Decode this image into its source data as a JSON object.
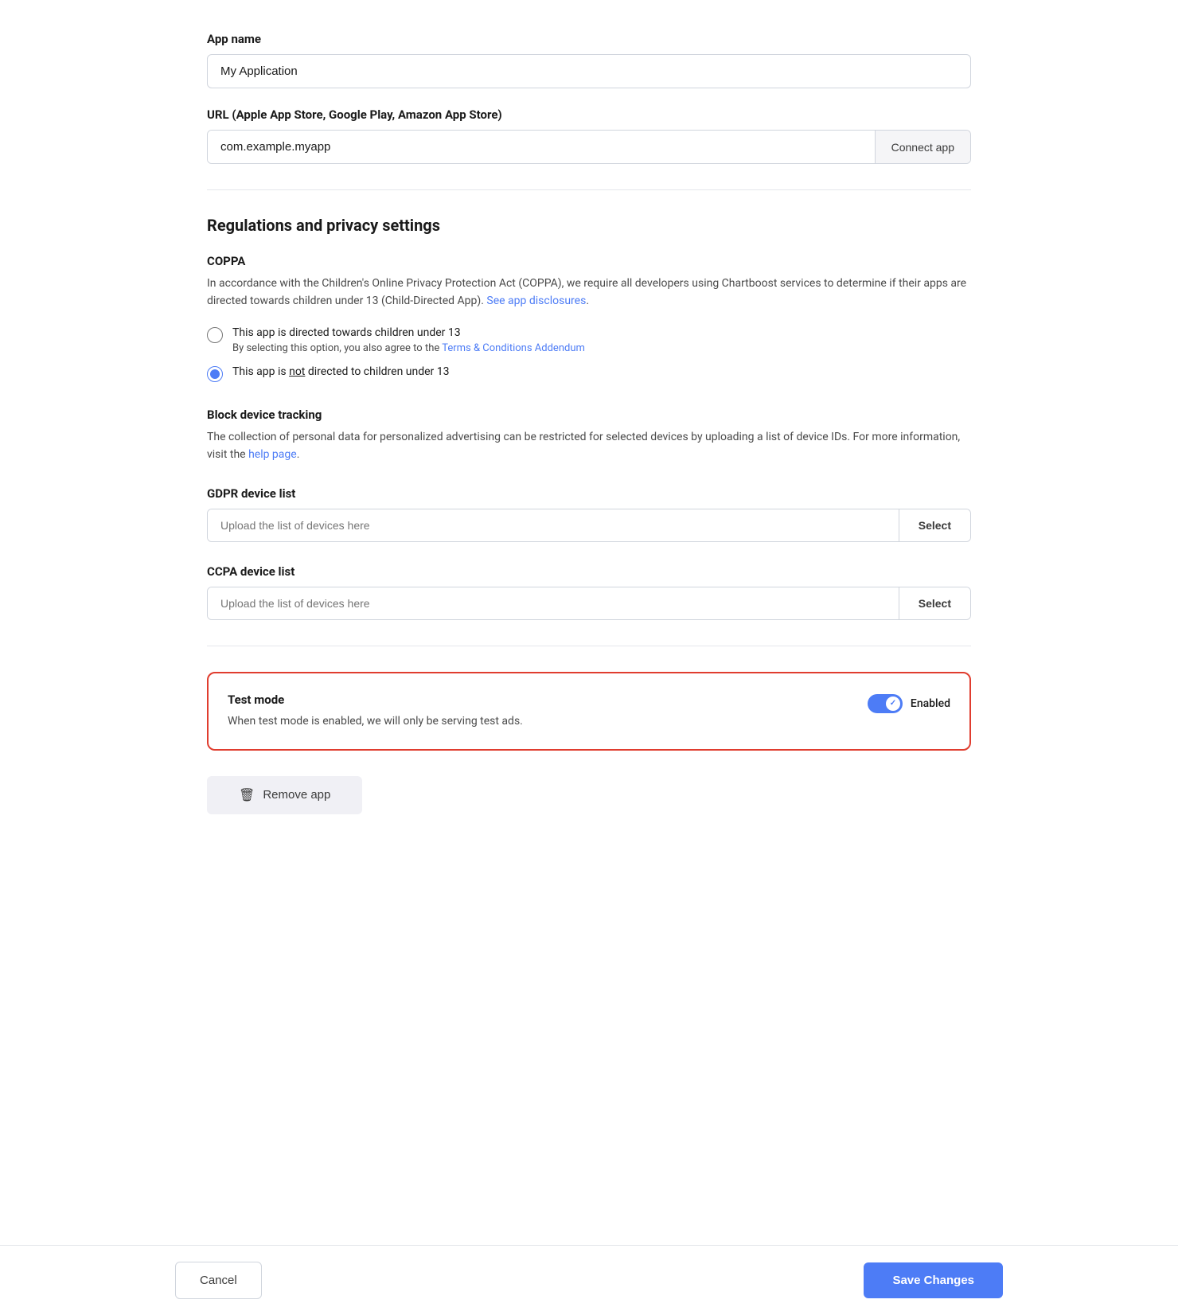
{
  "app_name": {
    "label": "App name",
    "value": "My Application",
    "placeholder": "My Application"
  },
  "url_field": {
    "label": "URL (Apple App Store, Google Play, Amazon App Store)",
    "value": "com.example.myapp",
    "placeholder": "com.example.myapp",
    "connect_button_label": "Connect app"
  },
  "regulations": {
    "section_title": "Regulations and privacy settings",
    "coppa": {
      "title": "COPPA",
      "description_part1": "In accordance with the Children's Online Privacy Protection Act (COPPA), we require all developers using Chartboost services to determine if their apps are directed towards children under 13 (Child-Directed App). ",
      "see_disclosures_link": "See app disclosures",
      "description_end": ".",
      "option_directed_label": "This app is directed towards children under 13",
      "option_directed_sublabel_prefix": "By selecting this option, you also agree to the ",
      "terms_link": "Terms & Conditions Addendum",
      "option_not_directed_label_prefix": "This app is ",
      "option_not_directed_underline": "not",
      "option_not_directed_label_suffix": " directed to children under 13"
    },
    "block_tracking": {
      "title": "Block device tracking",
      "description_part1": "The collection of personal data for personalized advertising can be restricted for selected devices by uploading a list of device IDs. For more information, visit the ",
      "help_link": "help page",
      "description_end": "."
    },
    "gdpr": {
      "label": "GDPR device list",
      "placeholder": "Upload the list of devices here",
      "select_button": "Select"
    },
    "ccpa": {
      "label": "CCPA device list",
      "placeholder": "Upload the list of devices here",
      "select_button": "Select"
    }
  },
  "test_mode": {
    "title": "Test mode",
    "description": "When test mode is enabled, we will only be serving test ads.",
    "toggle_label": "Enabled",
    "enabled": true
  },
  "remove_app": {
    "button_label": "Remove app"
  },
  "footer": {
    "cancel_label": "Cancel",
    "save_label": "Save Changes"
  }
}
